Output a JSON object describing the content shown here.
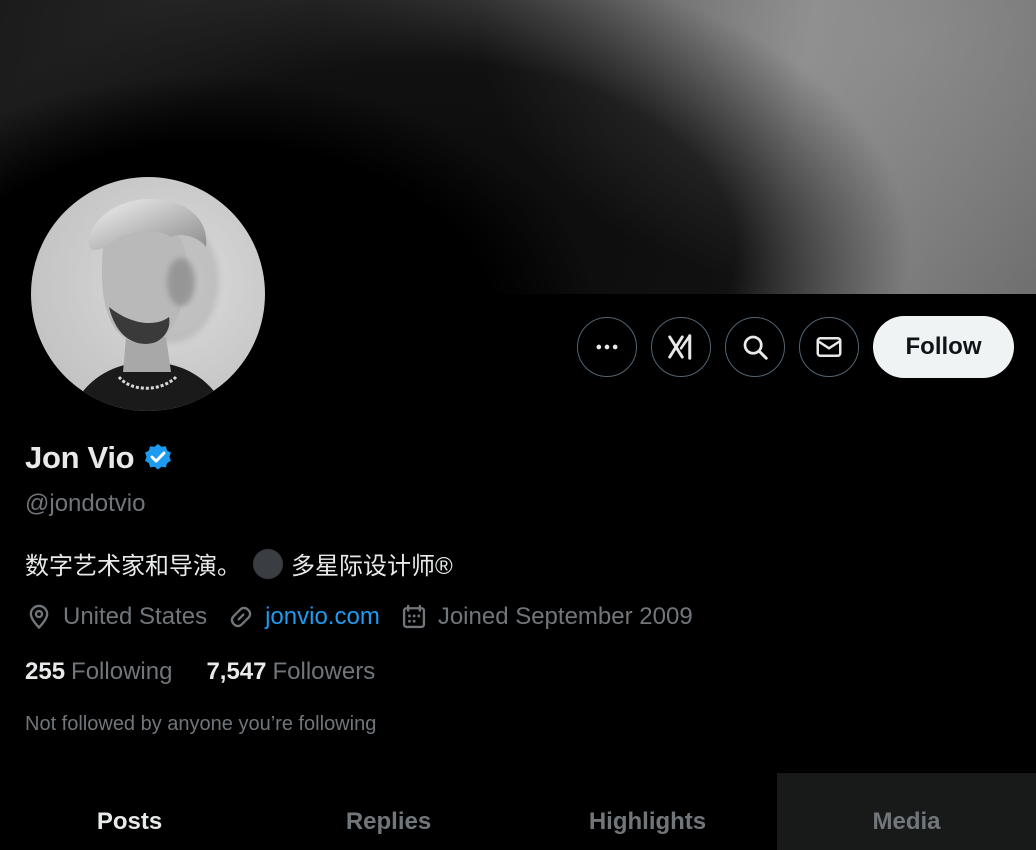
{
  "profile": {
    "display_name": "Jon Vio",
    "handle": "@jondotvio",
    "bio_text_before": "数字艺术家和导演。",
    "bio_text_after": "多星际设计师®",
    "location": "United States",
    "website": "jonvio.com",
    "joined": "Joined September 2009",
    "following_count": "255",
    "following_label": "Following",
    "followers_count": "7,547",
    "followers_label": "Followers",
    "not_followed_text": "Not followed by anyone you’re following"
  },
  "actions": {
    "more_icon": "more-icon",
    "grok_icon": "grok-icon",
    "search_icon": "search-icon",
    "message_icon": "envelope-icon",
    "follow_label": "Follow"
  },
  "tabs": [
    {
      "label": "Posts",
      "active": true
    },
    {
      "label": "Replies",
      "active": false
    },
    {
      "label": "Highlights",
      "active": false
    },
    {
      "label": "Media",
      "active": false
    }
  ],
  "colors": {
    "background": "#000000",
    "text_primary": "#e7e9ea",
    "text_secondary": "#71767b",
    "link": "#1d9bf0",
    "verified": "#1d9bf0",
    "follow_button_bg": "#eff3f4"
  }
}
